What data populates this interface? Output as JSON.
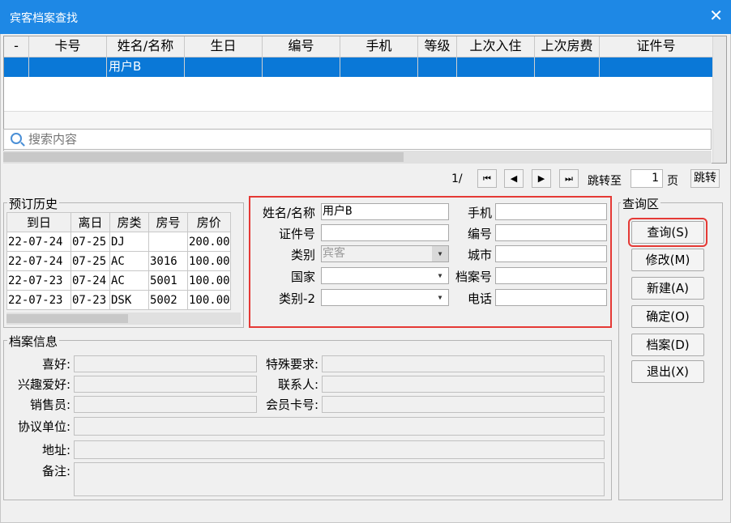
{
  "window": {
    "title": "宾客档案查找",
    "close": "✕"
  },
  "grid": {
    "headers": [
      "-",
      "卡号",
      "姓名/名称",
      "生日",
      "编号",
      "手机",
      "等级",
      "上次入住",
      "上次房费",
      "证件号"
    ],
    "selected_row": [
      "",
      "",
      "用户B",
      "",
      "",
      "",
      "",
      "",
      "",
      ""
    ]
  },
  "search": {
    "placeholder": "搜索内容"
  },
  "pager": {
    "page": "1/",
    "first": "⏮",
    "prev": "◀",
    "next": "▶",
    "last": "⏭",
    "goto_label": "跳转至",
    "goto_value": "1",
    "page_unit": "页",
    "goto_button": "跳转"
  },
  "booking_history": {
    "title": "预订历史",
    "headers": [
      "到日",
      "离日",
      "房类",
      "房号",
      "房价"
    ],
    "rows": [
      [
        "22-07-24",
        "07-25",
        "DJ",
        "",
        "200.00"
      ],
      [
        "22-07-24",
        "07-25",
        "AC",
        "3016",
        "100.00"
      ],
      [
        "22-07-23",
        "07-24",
        "AC",
        "5001",
        "100.00"
      ],
      [
        "22-07-23",
        "07-23",
        "DSK",
        "5002",
        "100.00"
      ]
    ]
  },
  "form": {
    "name_label": "姓名/名称",
    "name_value": "用户B",
    "mobile_label": "手机",
    "mobile_value": "",
    "id_label": "证件号",
    "id_value": "",
    "code_label": "编号",
    "code_value": "",
    "category_label": "类别",
    "category_value": "宾客",
    "city_label": "城市",
    "city_value": "",
    "country_label": "国家",
    "country_value": "",
    "file_no_label": "档案号",
    "file_no_value": "",
    "category2_label": "类别-2",
    "category2_value": "",
    "phone_label": "电话",
    "phone_value": ""
  },
  "query_area": {
    "title": "查询区",
    "buttons": [
      "查询(S)",
      "修改(M)",
      "新建(A)",
      "确定(O)",
      "档案(D)",
      "退出(X)"
    ]
  },
  "archive": {
    "title": "档案信息",
    "labels": {
      "hobby": "喜好:",
      "special": "特殊要求:",
      "interest": "兴趣爱好:",
      "contact": "联系人:",
      "sales": "销售员:",
      "member_card": "会员卡号:",
      "agreement": "协议单位:",
      "address": "地址:",
      "remark": "备注:"
    }
  },
  "colors": {
    "titlebar": "#1e88e5",
    "selection": "#0a78d7",
    "highlight": "#e53935"
  }
}
